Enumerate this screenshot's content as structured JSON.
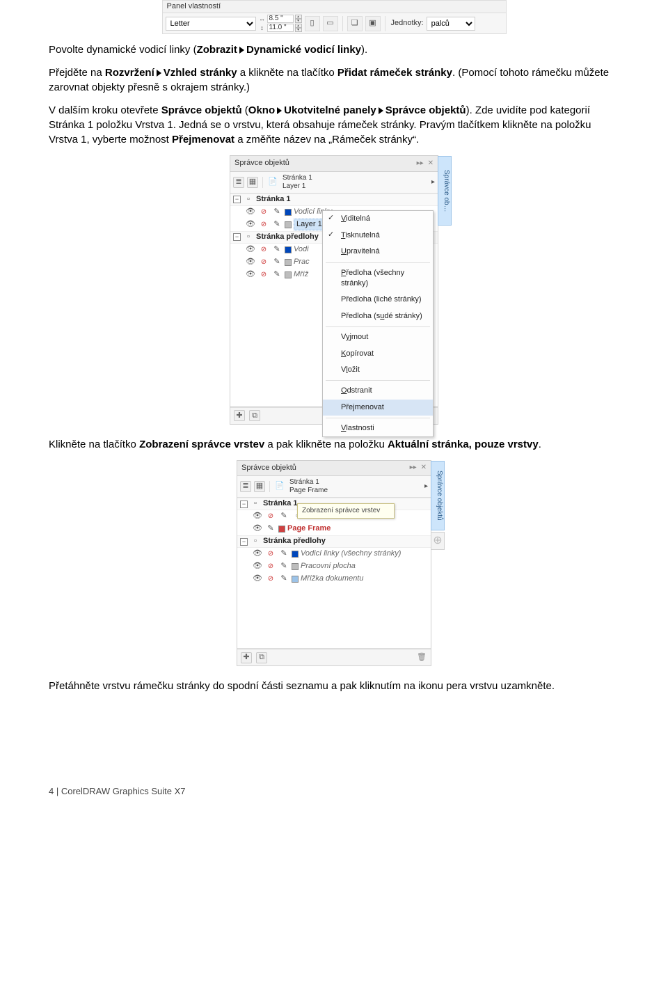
{
  "propbar": {
    "title": "Panel vlastností",
    "paper": "Letter",
    "width": "8.5 \"",
    "height": "11.0 \"",
    "units_label": "Jednotky:",
    "units_value": "palců"
  },
  "para1_a": "Povolte dynamické vodicí linky (",
  "para1_b": "Zobrazit",
  "para1_c": "Dynamické vodicí linky",
  "para1_d": ").",
  "para2_a": "Přejděte na ",
  "para2_b": "Rozvržení",
  "para2_c": "Vzhled stránky",
  "para2_d": " a klikněte na tlačítko ",
  "para2_e": "Přidat rámeček stránky",
  "para2_f": ". (Pomocí tohoto rámečku můžete zarovnat objekty přesně s okrajem stránky.)",
  "para3_a": "V dalším kroku otevřete ",
  "para3_b": "Správce objektů",
  "para3_c": " (",
  "para3_d": "Okno",
  "para3_e": "Ukotvitelné panely",
  "para3_f": "Správce objektů",
  "para3_g": "). Zde uvidíte pod kategorií Stránka 1 položku Vrstva 1. Jedná se o vrstvu, která obsahuje rámeček stránky. Pravým tlačítkem klikněte na položku Vrstva 1, vyberte možnost ",
  "para3_h": "Přejmenovat",
  "para3_i": " a změňte název na „Rámeček stránky“.",
  "om1": {
    "title": "Správce objektů",
    "head_line1": "Stránka 1",
    "head_line2": "Layer 1",
    "page1": "Stránka 1",
    "guides": "Vodicí linky",
    "layer1": "Layer 1",
    "masterpage": "Stránka předlohy",
    "master_guides": "Vodi",
    "master_desktop": "Prac",
    "master_grid": "Mříž",
    "sidetab": "Správce ob…"
  },
  "ctx": {
    "visible": "Viditelná",
    "printable": "Tisknutelná",
    "editable": "Upravitelná",
    "master_all": "Předloha (všechny stránky)",
    "master_odd": "Předloha (liché stránky)",
    "master_even": "Předloha (sudé stránky)",
    "cut": "Vyjmout",
    "copy": "Kopírovat",
    "paste": "Vložit",
    "delete": "Odstranit",
    "rename": "Přejmenovat",
    "properties": "Vlastnosti"
  },
  "para4_a": "Klikněte na tlačítko ",
  "para4_b": "Zobrazení správce vrstev",
  "para4_c": " a pak klikněte na položku ",
  "para4_d": "Aktuální stránka, pouze vrstvy",
  "para4_e": ".",
  "om2": {
    "title": "Správce objektů",
    "head_line1": "Stránka 1",
    "head_line2": "Page Frame",
    "page1": "Stránka 1",
    "tooltip": "Zobrazení správce vrstev",
    "pageframe": "Page Frame",
    "masterpage": "Stránka předlohy",
    "master_guides": "Vodicí linky (všechny stránky)",
    "master_desktop": "Pracovní plocha",
    "master_grid": "Mřížka dokumentu",
    "sidetab": "Správce objektů"
  },
  "para5": "Přetáhněte vrstvu rámečku stránky do spodní části seznamu a pak kliknutím na ikonu pera vrstvu uzamkněte.",
  "footer": "4 | CorelDRAW Graphics Suite X7"
}
